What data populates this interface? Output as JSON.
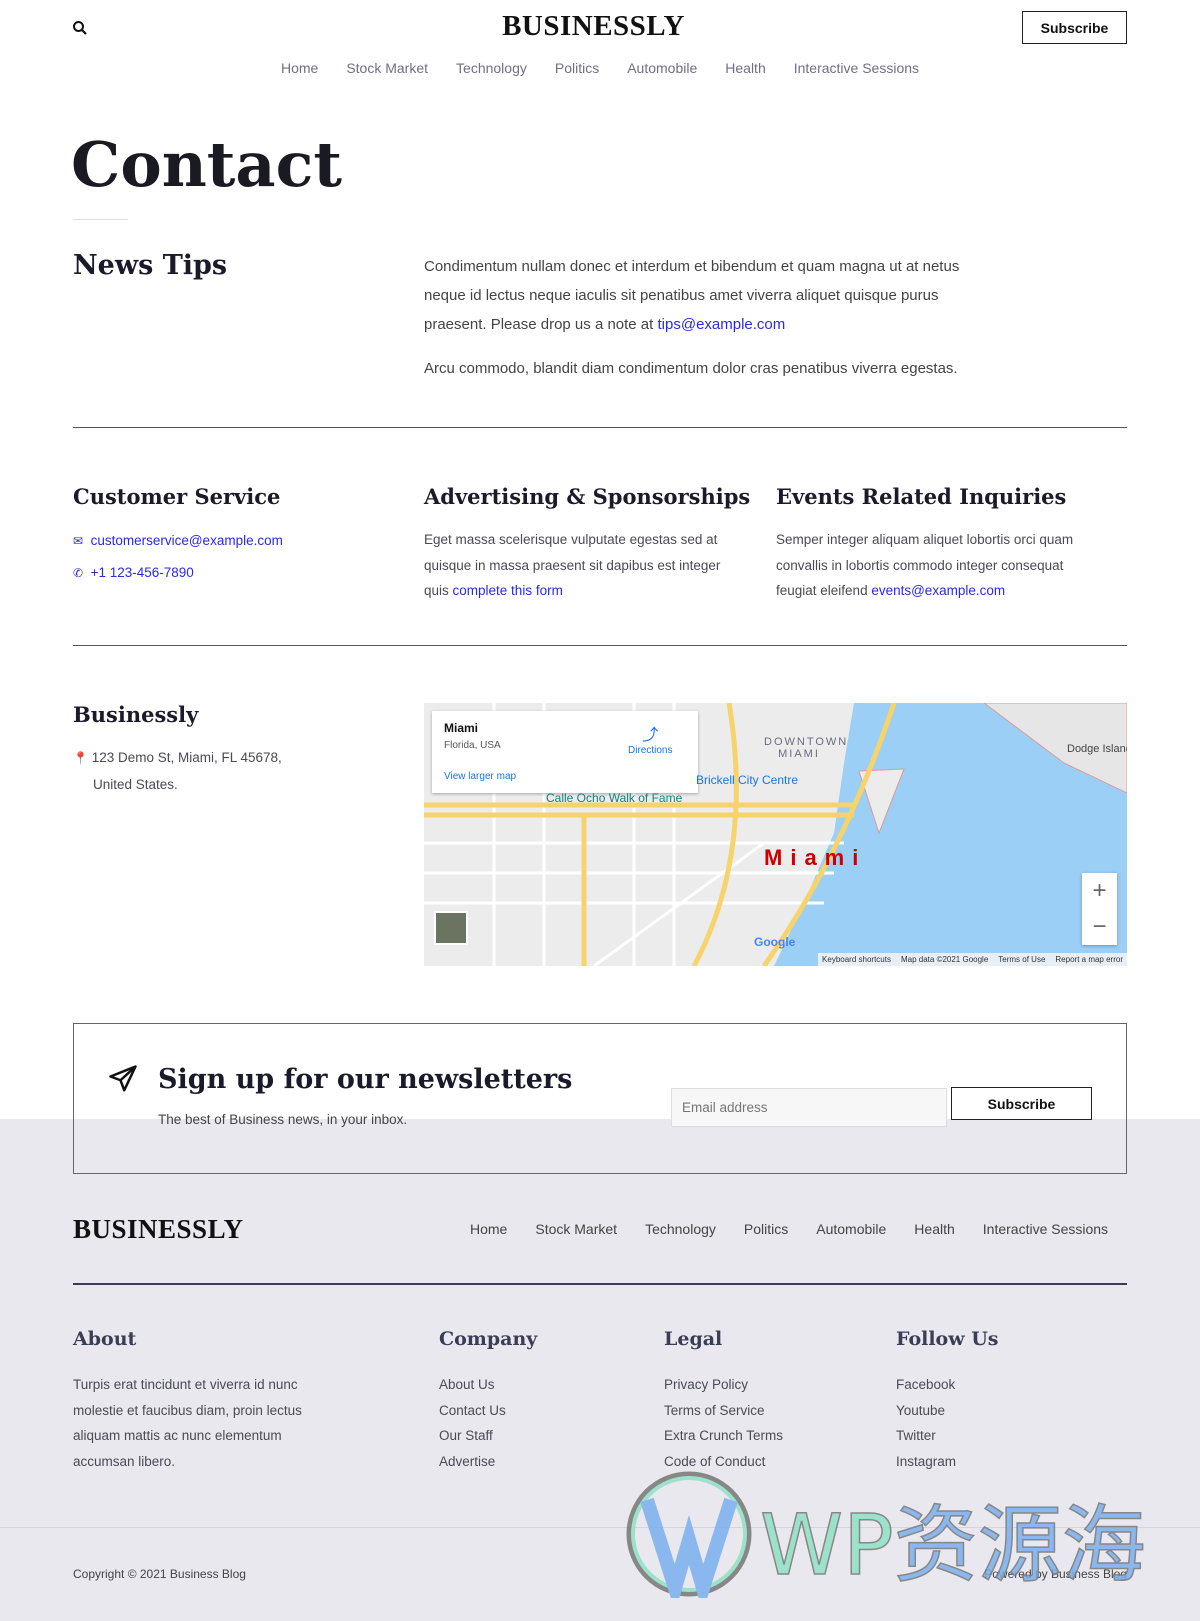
{
  "header": {
    "logo": "BUSINESSLY",
    "subscribe_label": "Subscribe",
    "nav": [
      "Home",
      "Stock Market",
      "Technology",
      "Politics",
      "Automobile",
      "Health",
      "Interactive Sessions"
    ]
  },
  "page_title": "Contact",
  "news_tips": {
    "heading": "News Tips",
    "para1": "Condimentum nullam donec et interdum et bibendum et quam magna ut at netus neque id lectus neque iaculis sit penatibus amet viverra aliquet quisque purus praesent. Please drop us a note at ",
    "email": "tips@example.com",
    "para2": "Arcu commodo, blandit diam condimentum dolor cras penatibus viverra egestas."
  },
  "customer_service": {
    "heading": "Customer Service",
    "email": "customerservice@example.com",
    "phone": "+1 123-456-7890"
  },
  "advertising": {
    "heading": "Advertising & Sponsorships",
    "text": "Eget massa scelerisque vulputate egestas sed at quisque in massa praesent sit dapibus est integer quis ",
    "link": "complete this form"
  },
  "events": {
    "heading": "Events Related Inquiries",
    "text": "Semper integer aliquam aliquet lobortis orci quam convallis in lobortis commodo  integer consequat feugiat eleifend ",
    "link": "events@example.com"
  },
  "address": {
    "heading": "Businessly",
    "line1": "123 Demo St, Miami, FL 45678,",
    "line2": "United States."
  },
  "map": {
    "place": "Miami",
    "region": "Florida, USA",
    "directions": "Directions",
    "view_larger": "View larger map",
    "city_label": "Miami",
    "downtown": "DOWNTOWN MIAMI",
    "brickell": "Brickell City Centre",
    "calle_ocho": "Calle Ocho Walk of Fame",
    "dodge": "Dodge Island",
    "google": "Google",
    "footer_links": [
      "Keyboard shortcuts",
      "Map data ©2021 Google",
      "Terms of Use",
      "Report a map error"
    ],
    "zoom_in": "+",
    "zoom_out": "−"
  },
  "newsletter": {
    "heading": "Sign up for our newsletters",
    "subtext": "The best of Business news, in your inbox.",
    "email_placeholder": "Email address",
    "subscribe_label": "Subscribe"
  },
  "footer": {
    "logo": "BUSINESSLY",
    "nav": [
      "Home",
      "Stock Market",
      "Technology",
      "Politics",
      "Automobile",
      "Health",
      "Interactive Sessions"
    ],
    "about": {
      "heading": "About",
      "text": "Turpis erat tincidunt et viverra id nunc molestie et faucibus diam, proin lectus aliquam mattis ac nunc elementum accumsan libero."
    },
    "company": {
      "heading": "Company",
      "links": [
        "About Us",
        "Contact Us",
        "Our Staff",
        "Advertise"
      ]
    },
    "legal": {
      "heading": "Legal",
      "links": [
        "Privacy Policy",
        "Terms of Service",
        "Extra Crunch Terms",
        "Code of Conduct"
      ]
    },
    "follow": {
      "heading": "Follow Us",
      "links": [
        "Facebook",
        "Youtube",
        "Twitter",
        "Instagram"
      ]
    },
    "copyright": "Copyright © 2021 Business Blog",
    "powered": "Powered by Business Blog"
  },
  "watermark": "WP资源海"
}
